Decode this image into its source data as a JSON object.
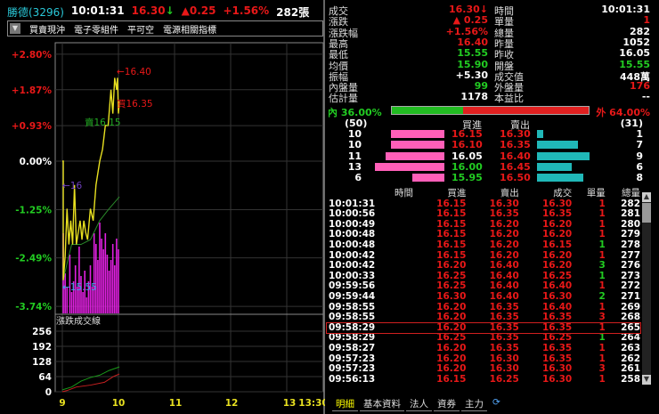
{
  "header": {
    "stock": "勝德(3296)",
    "time": "10:01:31",
    "price": "16.30",
    "arrow": "↓",
    "change": "▲0.25",
    "pct": "+1.56%",
    "volume": "282張"
  },
  "tags": [
    "買賣現沖",
    "電子零組件",
    "平可空",
    "電源相關指標"
  ],
  "quote": {
    "left": [
      {
        "label": "成交",
        "value": "16.30↓",
        "color": "r"
      },
      {
        "label": "漲跌",
        "value": "▲ 0.25",
        "color": "r"
      },
      {
        "label": "漲跌幅",
        "value": "+1.56%",
        "color": "r"
      },
      {
        "label": "最高",
        "value": "16.40",
        "color": "r"
      },
      {
        "label": "最低",
        "value": "15.55",
        "color": "g"
      },
      {
        "label": "均價",
        "value": "15.90",
        "color": "g"
      },
      {
        "label": "振幅",
        "value": "+5.30",
        "color": "w"
      },
      {
        "label": "內盤量",
        "value": "99",
        "color": "g"
      },
      {
        "label": "估計量",
        "value": "1178",
        "color": "w"
      }
    ],
    "right": [
      {
        "label": "時間",
        "value": "10:01:31",
        "color": "w"
      },
      {
        "label": "單量",
        "value": "1",
        "color": "r"
      },
      {
        "label": "總量",
        "value": "282",
        "color": "w"
      },
      {
        "label": "昨量",
        "value": "1052",
        "color": "w"
      },
      {
        "label": "昨收",
        "value": "16.05",
        "color": "w"
      },
      {
        "label": "開盤",
        "value": "15.55",
        "color": "g"
      },
      {
        "label": "成交值",
        "value": "448萬",
        "color": "w"
      },
      {
        "label": "外盤量",
        "value": "176",
        "color": "r"
      },
      {
        "label": "本益比",
        "value": "--",
        "color": "w"
      }
    ]
  },
  "ratio": {
    "inner_label": "內 36.00%",
    "outer_label": "外 64.00%",
    "inner": 36
  },
  "book": {
    "bid_total": "(50)",
    "ask_total": "(31)",
    "bid_header": "買進",
    "ask_header": "賣出",
    "rows": [
      {
        "bq": "10",
        "bid": "16.15",
        "bc": "r",
        "ask": "16.30",
        "ac": "r",
        "aq": "1"
      },
      {
        "bq": "10",
        "bid": "16.10",
        "bc": "r",
        "ask": "16.35",
        "ac": "r",
        "aq": "7"
      },
      {
        "bq": "11",
        "bid": "16.05",
        "bc": "w",
        "ask": "16.40",
        "ac": "r",
        "aq": "9"
      },
      {
        "bq": "13",
        "bid": "16.00",
        "bc": "g",
        "ask": "16.45",
        "ac": "r",
        "aq": "6"
      },
      {
        "bq": "6",
        "bid": "15.95",
        "bc": "g",
        "ask": "16.50",
        "ac": "r",
        "aq": "8"
      }
    ]
  },
  "ticks": {
    "headers": [
      "時間",
      "買進",
      "賣出",
      "成交",
      "單量",
      "總量"
    ],
    "selected": 12,
    "rows": [
      [
        "10:01:31",
        "16.15",
        "16.30",
        "16.30",
        "1",
        "282",
        "r"
      ],
      [
        "10:00:56",
        "16.15",
        "16.35",
        "16.35",
        "1",
        "281",
        "r"
      ],
      [
        "10:00:49",
        "16.15",
        "16.20",
        "16.20",
        "1",
        "280",
        "r"
      ],
      [
        "10:00:48",
        "16.15",
        "16.20",
        "16.20",
        "1",
        "279",
        "r"
      ],
      [
        "10:00:48",
        "16.15",
        "16.20",
        "16.15",
        "1",
        "278",
        "g"
      ],
      [
        "10:00:42",
        "16.15",
        "16.20",
        "16.20",
        "1",
        "277",
        "r"
      ],
      [
        "10:00:42",
        "16.20",
        "16.40",
        "16.20",
        "3",
        "276",
        "g"
      ],
      [
        "10:00:33",
        "16.25",
        "16.40",
        "16.25",
        "1",
        "273",
        "g"
      ],
      [
        "09:59:56",
        "16.25",
        "16.40",
        "16.40",
        "1",
        "272",
        "r"
      ],
      [
        "09:59:44",
        "16.30",
        "16.40",
        "16.30",
        "2",
        "271",
        "g"
      ],
      [
        "09:58:55",
        "16.20",
        "16.35",
        "16.40",
        "1",
        "269",
        "r"
      ],
      [
        "09:58:55",
        "16.20",
        "16.35",
        "16.35",
        "3",
        "268",
        "r"
      ],
      [
        "09:58:29",
        "16.20",
        "16.35",
        "16.35",
        "1",
        "265",
        "r"
      ],
      [
        "09:58:29",
        "16.25",
        "16.35",
        "16.25",
        "1",
        "264",
        "g"
      ],
      [
        "09:58:27",
        "16.20",
        "16.35",
        "16.35",
        "1",
        "263",
        "r"
      ],
      [
        "09:57:23",
        "16.20",
        "16.30",
        "16.35",
        "1",
        "262",
        "r"
      ],
      [
        "09:57:23",
        "16.20",
        "16.30",
        "16.30",
        "3",
        "261",
        "r"
      ],
      [
        "09:56:13",
        "16.15",
        "16.25",
        "16.30",
        "1",
        "258",
        "r"
      ]
    ]
  },
  "tabs": [
    "明細",
    "基本資料",
    "法人",
    "資券",
    "主力"
  ],
  "chart_data": {
    "type": "line",
    "ref_price": 16.05,
    "y_ticks": [
      "+2.80%",
      "+1.87%",
      "+0.93%",
      "0.00%",
      "-1.25%",
      "-2.49%",
      "-3.74%"
    ],
    "y_values": [
      2.8,
      1.87,
      0.93,
      0,
      -1.25,
      -2.49,
      -3.74
    ],
    "x_ticks": [
      "9",
      "10",
      "11",
      "12",
      "13",
      "13:30"
    ],
    "annotations": {
      "high": "←16.40",
      "low": "←15.55",
      "bid": "買16.35",
      "ask": "賣16.15",
      "mid": "←16"
    },
    "price": [
      [
        0,
        16.05
      ],
      [
        1,
        16.05
      ],
      [
        1,
        15.55
      ],
      [
        3,
        15.65
      ],
      [
        5,
        15.85
      ],
      [
        7,
        15.7
      ],
      [
        9,
        15.8
      ],
      [
        11,
        15.7
      ],
      [
        13,
        15.95
      ],
      [
        15,
        15.7
      ],
      [
        17,
        15.75
      ],
      [
        19,
        15.8
      ],
      [
        21,
        15.72
      ],
      [
        23,
        15.8
      ],
      [
        25,
        15.75
      ],
      [
        27,
        15.72
      ],
      [
        30,
        15.85
      ],
      [
        33,
        15.8
      ],
      [
        36,
        15.95
      ],
      [
        40,
        16.05
      ],
      [
        43,
        16.1
      ],
      [
        46,
        16.2
      ],
      [
        49,
        16.2
      ],
      [
        52,
        16.35
      ],
      [
        54,
        16.25
      ],
      [
        56,
        16.4
      ],
      [
        58,
        16.35
      ],
      [
        59,
        16.4
      ],
      [
        60,
        16.25
      ],
      [
        61,
        16.3
      ]
    ],
    "avg": [
      [
        1,
        15.55
      ],
      [
        5,
        15.62
      ],
      [
        10,
        15.7
      ],
      [
        20,
        15.7
      ],
      [
        30,
        15.72
      ],
      [
        40,
        15.8
      ],
      [
        50,
        15.85
      ],
      [
        61,
        15.9
      ]
    ],
    "volume": [
      [
        1,
        30
      ],
      [
        3,
        15
      ],
      [
        5,
        10
      ],
      [
        8,
        22
      ],
      [
        10,
        8
      ],
      [
        12,
        12
      ],
      [
        14,
        18
      ],
      [
        16,
        10
      ],
      [
        18,
        25
      ],
      [
        20,
        14
      ],
      [
        22,
        8
      ],
      [
        24,
        16
      ],
      [
        26,
        6
      ],
      [
        28,
        12
      ],
      [
        30,
        18
      ],
      [
        32,
        10
      ],
      [
        34,
        30
      ],
      [
        36,
        26
      ],
      [
        38,
        20
      ],
      [
        40,
        34
      ],
      [
        42,
        28
      ],
      [
        44,
        24
      ],
      [
        46,
        30
      ],
      [
        48,
        22
      ],
      [
        50,
        16
      ],
      [
        52,
        20
      ],
      [
        54,
        26
      ],
      [
        56,
        18
      ],
      [
        58,
        28
      ],
      [
        60,
        24
      ]
    ],
    "lower": {
      "title": "漲跌成交線",
      "y_ticks": [
        "256",
        "192",
        "128",
        "64",
        "0"
      ],
      "y_values": [
        256,
        192,
        128,
        64,
        0
      ],
      "outer": [
        [
          0,
          8
        ],
        [
          10,
          20
        ],
        [
          20,
          45
        ],
        [
          30,
          60
        ],
        [
          40,
          70
        ],
        [
          50,
          90
        ],
        [
          61,
          105
        ]
      ],
      "inner": [
        [
          0,
          0
        ],
        [
          5,
          5
        ],
        [
          15,
          20
        ],
        [
          30,
          28
        ],
        [
          45,
          40
        ],
        [
          55,
          65
        ],
        [
          61,
          75
        ]
      ]
    }
  }
}
